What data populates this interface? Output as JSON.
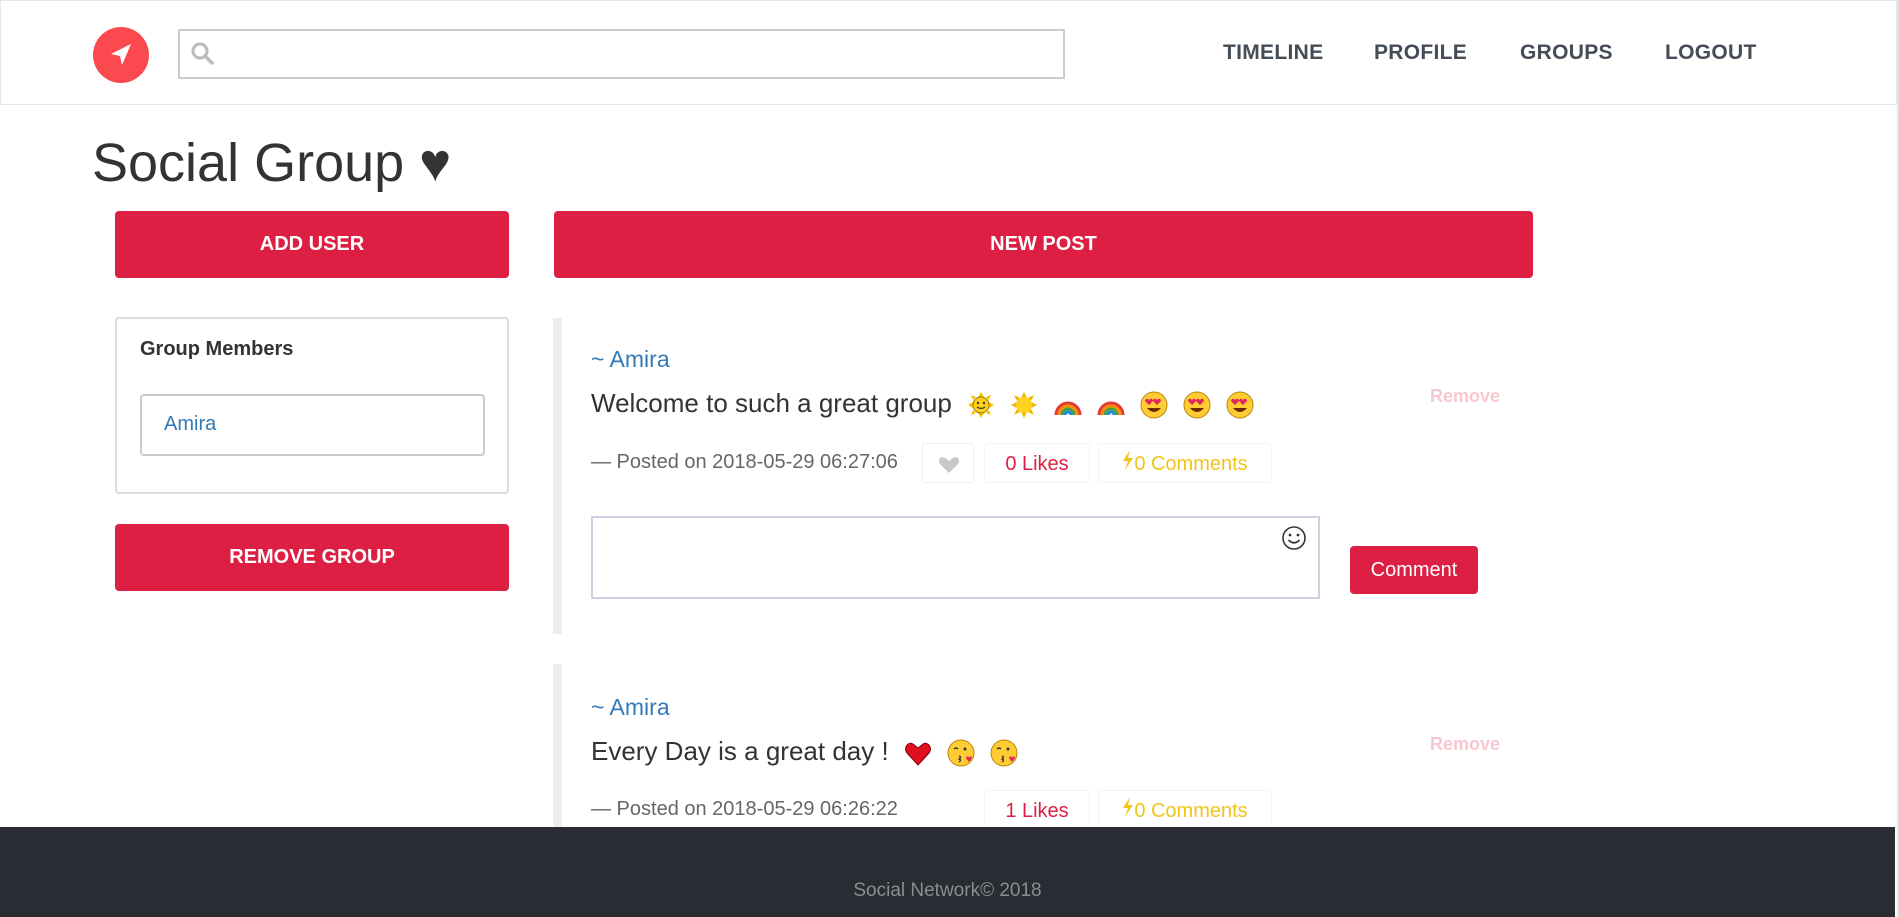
{
  "nav": {
    "search_placeholder": "",
    "links": [
      "TIMELINE",
      "PROFILE",
      "GROUPS",
      "LOGOUT"
    ]
  },
  "page": {
    "title": "Social Group ♥"
  },
  "actions": {
    "add_user": "ADD USER",
    "new_post": "NEW POST",
    "remove_group": "REMOVE GROUP"
  },
  "members": {
    "title": "Group Members",
    "items": [
      "Amira"
    ]
  },
  "posts": [
    {
      "author": "~ Amira",
      "text": "Welcome to such a great group",
      "emojis": [
        "sun-face-icon",
        "sun-icon",
        "rainbow-icon",
        "rainbow-icon",
        "heart-eyes-icon",
        "heart-eyes-icon",
        "heart-eyes-icon"
      ],
      "remove": "Remove",
      "date": "— Posted on 2018-05-29 06:27:06",
      "likes": "0 Likes",
      "comments": "0 Comments"
    },
    {
      "author": "~ Amira",
      "text": "Every Day is a great day !",
      "emojis": [
        "red-heart-icon",
        "kissing-face-icon",
        "kissing-face-icon"
      ],
      "remove": "Remove",
      "date": "— Posted on 2018-05-29 06:26:22",
      "likes": "1 Likes",
      "comments": "0 Comments"
    }
  ],
  "comment_form": {
    "value": "",
    "button": "Comment"
  },
  "footer": {
    "text": "Social Network© 2018"
  },
  "colors": {
    "accent": "#dc1f43",
    "logo": "#fa4a4f",
    "link": "#337ab7",
    "comments": "#f0c419",
    "footer_bg": "#292d33"
  }
}
